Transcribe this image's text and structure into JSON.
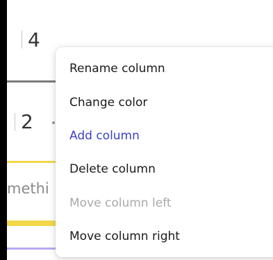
{
  "board": {
    "column_top": {
      "count": "4"
    },
    "column_second": {
      "count": "2"
    },
    "card_text": "methi"
  },
  "context_menu": {
    "items": [
      {
        "label": "Rename column",
        "state": "normal"
      },
      {
        "label": "Change color",
        "state": "normal"
      },
      {
        "label": "Add column",
        "state": "accent"
      },
      {
        "label": "Delete column",
        "state": "normal"
      },
      {
        "label": "Move column left",
        "state": "disabled"
      },
      {
        "label": "Move column right",
        "state": "normal"
      }
    ]
  },
  "colors": {
    "accent": "#3c3fc4",
    "disabled": "#a9a9a9",
    "yellow": "#f2d74a",
    "purple": "#b9a8ef"
  }
}
